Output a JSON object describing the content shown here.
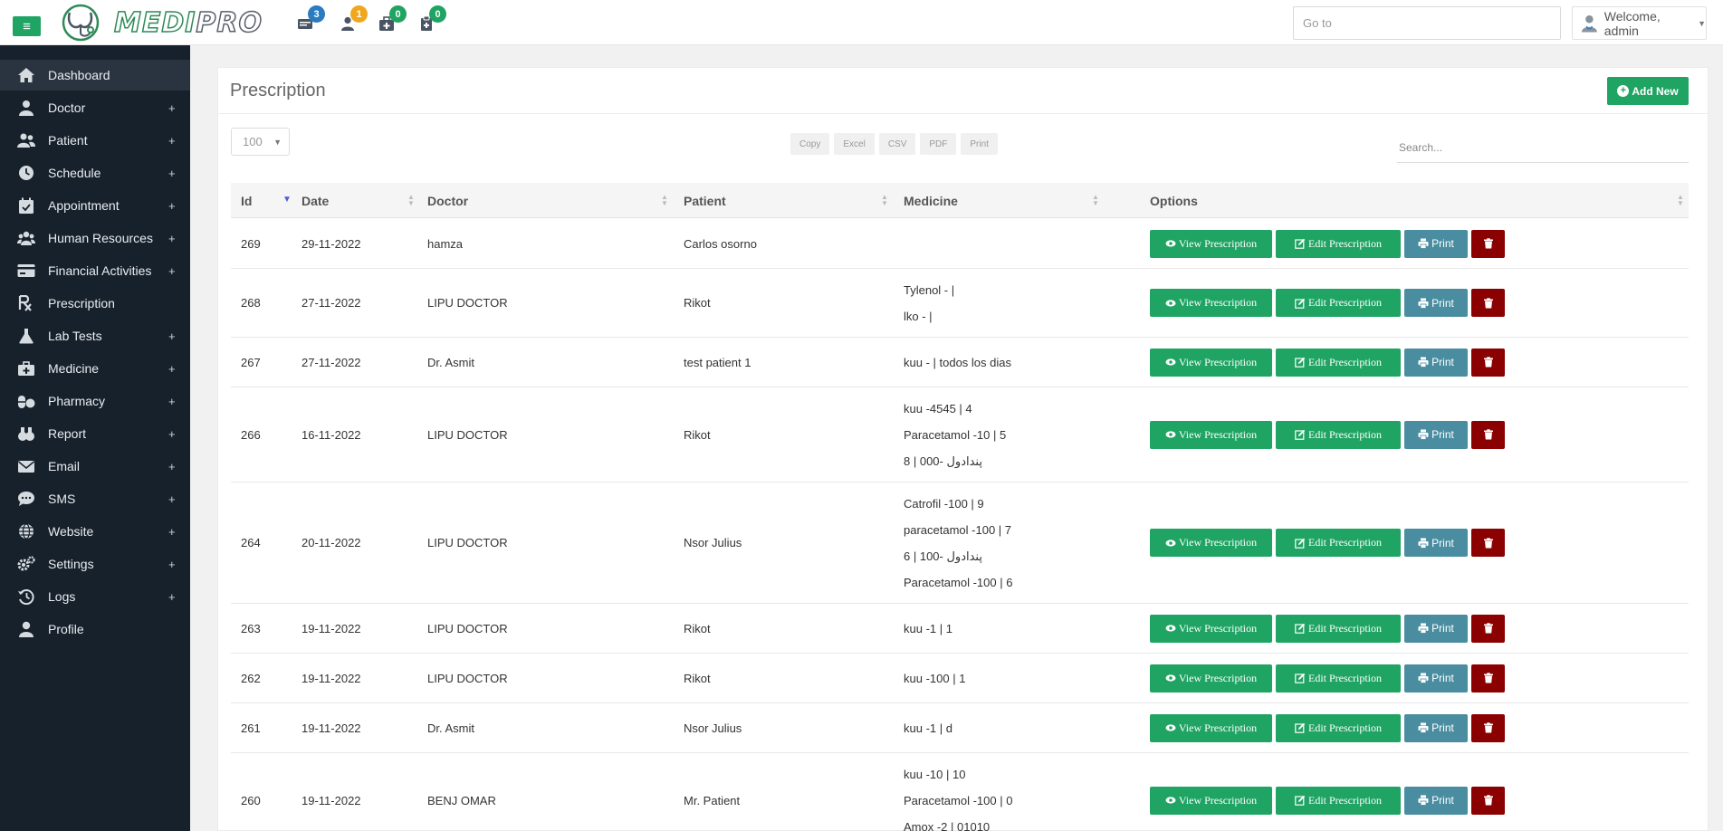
{
  "topbar": {
    "logo": {
      "text_a": "MEDI",
      "text_b": "PRO"
    },
    "notifications": [
      {
        "icon": "billing-icon",
        "count": "3",
        "color": "#2a7bc0"
      },
      {
        "icon": "user-icon",
        "count": "1",
        "color": "#f0a71f"
      },
      {
        "icon": "medkit-icon",
        "count": "0",
        "color": "#1fa463"
      },
      {
        "icon": "clipboard-icon",
        "count": "0",
        "color": "#1fa463"
      }
    ],
    "goto_placeholder": "Go to",
    "welcome": "Welcome, admin"
  },
  "sidebar": {
    "items": [
      {
        "label": "Dashboard",
        "icon": "home-icon",
        "expandable": false,
        "active": true
      },
      {
        "label": "Doctor",
        "icon": "doctor-icon",
        "expandable": true
      },
      {
        "label": "Patient",
        "icon": "users-icon",
        "expandable": true
      },
      {
        "label": "Schedule",
        "icon": "clock-icon",
        "expandable": true
      },
      {
        "label": "Appointment",
        "icon": "calendar-icon",
        "expandable": true
      },
      {
        "label": "Human Resources",
        "icon": "group-icon",
        "expandable": true
      },
      {
        "label": "Financial Activities",
        "icon": "credit-card-icon",
        "expandable": true
      },
      {
        "label": "Prescription",
        "icon": "prescription-icon",
        "expandable": false
      },
      {
        "label": "Lab Tests",
        "icon": "flask-icon",
        "expandable": true
      },
      {
        "label": "Medicine",
        "icon": "medkit-icon",
        "expandable": true
      },
      {
        "label": "Pharmacy",
        "icon": "pills-icon",
        "expandable": true
      },
      {
        "label": "Report",
        "icon": "report-icon",
        "expandable": true
      },
      {
        "label": "Email",
        "icon": "mail-icon",
        "expandable": true
      },
      {
        "label": "SMS",
        "icon": "sms-icon",
        "expandable": true
      },
      {
        "label": "Website",
        "icon": "globe-icon",
        "expandable": true
      },
      {
        "label": "Settings",
        "icon": "cogs-icon",
        "expandable": true
      },
      {
        "label": "Logs",
        "icon": "history-icon",
        "expandable": true
      },
      {
        "label": "Profile",
        "icon": "profile-icon",
        "expandable": false
      }
    ],
    "plus_symbol": "+"
  },
  "main": {
    "title": "Prescription",
    "add_new": "Add New",
    "page_length": "100",
    "export_buttons": [
      "Copy",
      "Excel",
      "CSV",
      "PDF",
      "Print"
    ],
    "search_placeholder": "Search...",
    "columns": [
      "Id",
      "Date",
      "Doctor",
      "Patient",
      "Medicine",
      "Options"
    ],
    "action_labels": {
      "view": "View Prescription",
      "edit": "Edit Prescription",
      "print": "Print"
    },
    "rows": [
      {
        "id": "269",
        "date": "29-11-2022",
        "doctor": "hamza",
        "patient": "Carlos osorno",
        "medicine": []
      },
      {
        "id": "268",
        "date": "27-11-2022",
        "doctor": "LIPU DOCTOR",
        "patient": "Rikot",
        "medicine": [
          "Tylenol - |",
          "lko - |"
        ]
      },
      {
        "id": "267",
        "date": "27-11-2022",
        "doctor": "Dr. Asmit",
        "patient": "test patient 1",
        "medicine": [
          "kuu - | todos los dias"
        ]
      },
      {
        "id": "266",
        "date": "16-11-2022",
        "doctor": "LIPU DOCTOR",
        "patient": "Rikot",
        "medicine": [
          "kuu -4545 | 4",
          "Paracetamol -10 | 5",
          "پندادول -000 | 8"
        ]
      },
      {
        "id": "264",
        "date": "20-11-2022",
        "doctor": "LIPU DOCTOR",
        "patient": "Nsor Julius",
        "medicine": [
          "Catrofil -100 | 9",
          "paracetamol -100 | 7",
          "پندادول -100 | 6",
          "Paracetamol -100 | 6"
        ]
      },
      {
        "id": "263",
        "date": "19-11-2022",
        "doctor": "LIPU DOCTOR",
        "patient": "Rikot",
        "medicine": [
          "kuu -1 | 1"
        ]
      },
      {
        "id": "262",
        "date": "19-11-2022",
        "doctor": "LIPU DOCTOR",
        "patient": "Rikot",
        "medicine": [
          "kuu -100 | 1"
        ]
      },
      {
        "id": "261",
        "date": "19-11-2022",
        "doctor": "Dr. Asmit",
        "patient": "Nsor Julius",
        "medicine": [
          "kuu -1 | d"
        ]
      },
      {
        "id": "260",
        "date": "19-11-2022",
        "doctor": "BENJ OMAR",
        "patient": "Mr. Patient",
        "medicine": [
          "kuu -10 | 10",
          "Paracetamol -100 | 0",
          "Amox -2 | 01010"
        ]
      }
    ]
  }
}
